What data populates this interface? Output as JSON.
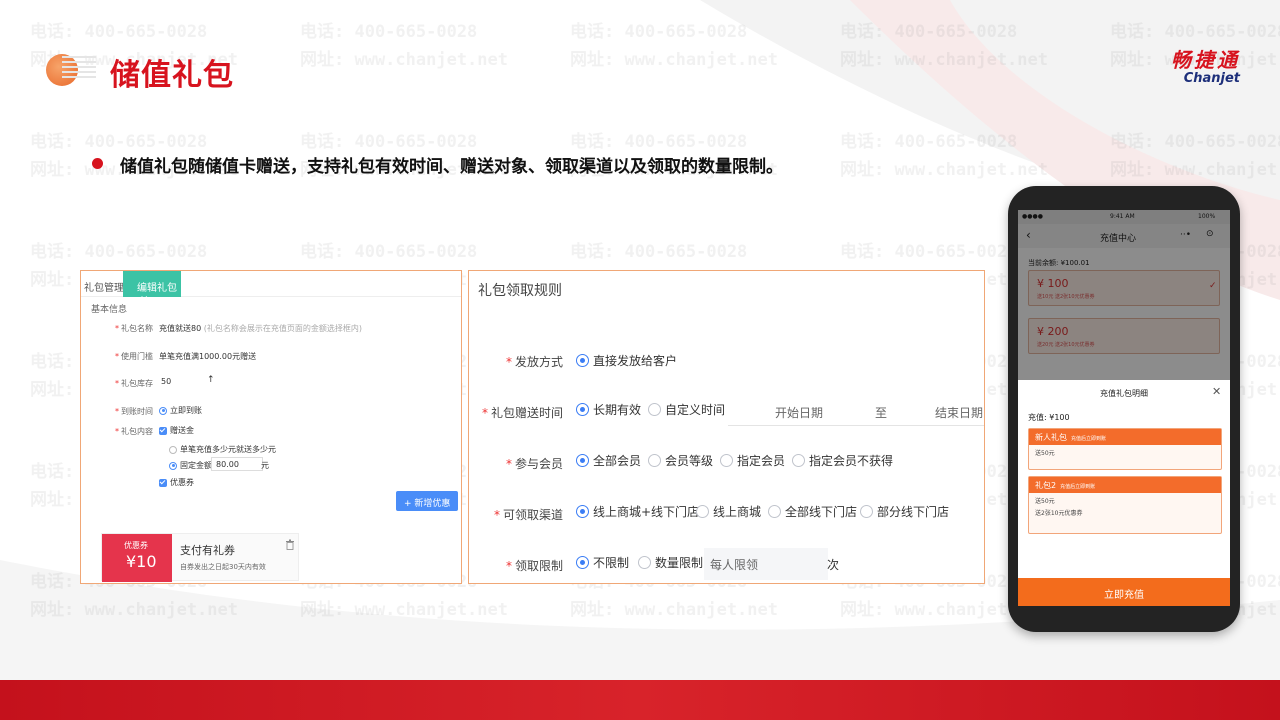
{
  "page": {
    "title": "储值礼包",
    "bullet": "储值礼包随储值卡赠送，支持礼包有效时间、赠送对象、领取渠道以及领取的数量限制。"
  },
  "brand": {
    "cn": "畅捷通",
    "en": "Chanjet"
  },
  "watermark": {
    "phone": "电话: 400-665-0028",
    "site": "网址: www.chanjet.net"
  },
  "admin_panel": {
    "tab_manage": "礼包管理",
    "tab_active": "编辑礼包",
    "tab_close": "×",
    "section": "基本信息",
    "fields": [
      {
        "label": "礼包名称",
        "value": "充值就送80",
        "hint": "(礼包名称会展示在充值页面的金额选择框内)"
      },
      {
        "label": "使用门槛",
        "value": "单笔充值满1000.00元赠送"
      },
      {
        "label": "礼包库存",
        "value": "50"
      },
      {
        "label": "到账时间",
        "value": "立即到账"
      },
      {
        "label": "礼包内容",
        "value": "赠送金"
      }
    ],
    "option_percent": "单笔充值多少元就送多少元",
    "option_fixed": "固定金额",
    "fixed_amount": "80.00",
    "fixed_unit": "元",
    "coupon_check": "优惠券",
    "new_coupon_button": "+ 新增优惠券",
    "coupon": {
      "tag": "优惠券",
      "value": "¥10",
      "name": "支付有礼券",
      "desc": "自券发出之日起30天内有效"
    }
  },
  "rules_panel": {
    "title": "礼包领取规则",
    "rows": [
      {
        "label": "发放方式",
        "options": [
          "直接发放给客户"
        ],
        "selected": 0
      },
      {
        "label": "礼包赠送时间",
        "options": [
          "长期有效",
          "自定义时间"
        ],
        "selected": 0
      },
      {
        "label": "参与会员",
        "options": [
          "全部会员",
          "会员等级",
          "指定会员",
          "指定会员不获得"
        ],
        "selected": 0
      },
      {
        "label": "可领取渠道",
        "options": [
          "线上商城+线下门店",
          "线上商城",
          "全部线下门店",
          "部分线下门店"
        ],
        "selected": 0
      },
      {
        "label": "领取限制",
        "options": [
          "不限制",
          "数量限制"
        ],
        "selected": 0
      }
    ],
    "date_start": "开始日期",
    "date_to": "至",
    "date_end": "结束日期",
    "limit_placeholder": "每人限领",
    "limit_unit": "次"
  },
  "phone": {
    "time": "9:41 AM",
    "battery": "100%",
    "nav_title": "充值中心",
    "balance": "当前余额: ¥100.01",
    "cards": [
      {
        "amount": "¥ 100",
        "sub": "送10元    送2张10元优惠券"
      },
      {
        "amount": "¥ 200",
        "sub": "送20元    送2张10元优惠券"
      }
    ],
    "sheet_title": "充值礼包明细",
    "charge": "充值: ¥100",
    "packages": [
      {
        "name": "新人礼包",
        "note": "充值后立即到账",
        "lines": [
          "送50元"
        ]
      },
      {
        "name": "礼包2",
        "note": "充值后立即到账",
        "lines": [
          "送50元",
          "送2张10元优惠券"
        ]
      }
    ],
    "button": "立即充值"
  }
}
